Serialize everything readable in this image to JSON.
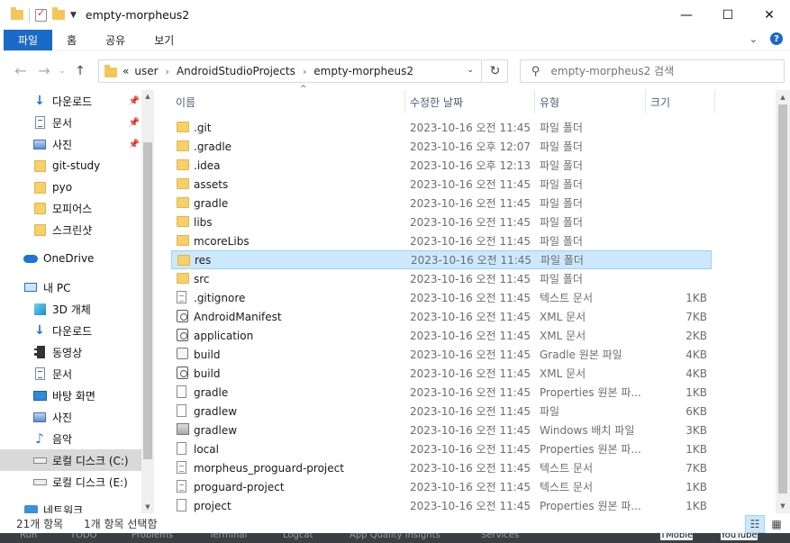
{
  "window": {
    "title": "empty-morpheus2",
    "minimize": "—",
    "maximize": "☐",
    "close": "✕"
  },
  "ribbon": {
    "tabs": [
      "파일",
      "홈",
      "공유",
      "보기"
    ],
    "expand": "⌄",
    "help": "?"
  },
  "address": {
    "back": "←",
    "forward": "→",
    "recent": "⌄",
    "up": "↑",
    "overflow": "«",
    "crumbs": [
      "user",
      "AndroidStudioProjects",
      "empty-morpheus2"
    ],
    "crumb_sep": "›",
    "dropdown": "⌄",
    "refresh": "↻"
  },
  "search": {
    "placeholder": "empty-morpheus2 검색",
    "icon": "⚲"
  },
  "nav": {
    "items": [
      {
        "label": "다운로드",
        "icon": "download-icon",
        "pinned": true
      },
      {
        "label": "문서",
        "icon": "document-icon",
        "pinned": true
      },
      {
        "label": "사진",
        "icon": "pictures-icon",
        "pinned": true
      },
      {
        "label": "git-study",
        "icon": "folder-icon"
      },
      {
        "label": "pyo",
        "icon": "folder-icon"
      },
      {
        "label": "모피어스",
        "icon": "folder-icon"
      },
      {
        "label": "스크린샷",
        "icon": "folder-icon"
      },
      {
        "label": "OneDrive",
        "icon": "onedrive-icon"
      },
      {
        "label": "내 PC",
        "icon": "pc-icon"
      },
      {
        "label": "3D 개체",
        "icon": "3d-objects-icon"
      },
      {
        "label": "다운로드",
        "icon": "download-icon"
      },
      {
        "label": "동영상",
        "icon": "video-icon"
      },
      {
        "label": "문서",
        "icon": "document-icon"
      },
      {
        "label": "바탕 화면",
        "icon": "desktop-icon"
      },
      {
        "label": "사진",
        "icon": "pictures-icon"
      },
      {
        "label": "음악",
        "icon": "music-icon"
      },
      {
        "label": "로컬 디스크 (C:)",
        "icon": "drive-icon",
        "selected": true
      },
      {
        "label": "로컬 디스크 (E:)",
        "icon": "drive-icon"
      },
      {
        "label": "네트워크",
        "icon": "network-icon"
      }
    ],
    "pin_glyph": "📌",
    "scroll_up": "▲",
    "scroll_down": "▼"
  },
  "columns": {
    "name": "이름",
    "date": "수정한 날짜",
    "type": "유형",
    "size": "크기",
    "sort_indicator": "^"
  },
  "files": [
    {
      "name": ".git",
      "date": "2023-10-16 오전 11:45",
      "type": "파일 폴더",
      "size": "",
      "icon": "folder-icon"
    },
    {
      "name": ".gradle",
      "date": "2023-10-16 오후 12:07",
      "type": "파일 폴더",
      "size": "",
      "icon": "folder-icon"
    },
    {
      "name": ".idea",
      "date": "2023-10-16 오후 12:13",
      "type": "파일 폴더",
      "size": "",
      "icon": "folder-icon"
    },
    {
      "name": "assets",
      "date": "2023-10-16 오전 11:45",
      "type": "파일 폴더",
      "size": "",
      "icon": "folder-icon"
    },
    {
      "name": "gradle",
      "date": "2023-10-16 오전 11:45",
      "type": "파일 폴더",
      "size": "",
      "icon": "folder-icon"
    },
    {
      "name": "libs",
      "date": "2023-10-16 오전 11:45",
      "type": "파일 폴더",
      "size": "",
      "icon": "folder-icon"
    },
    {
      "name": "mcoreLibs",
      "date": "2023-10-16 오전 11:45",
      "type": "파일 폴더",
      "size": "",
      "icon": "folder-icon"
    },
    {
      "name": "res",
      "date": "2023-10-16 오전 11:45",
      "type": "파일 폴더",
      "size": "",
      "icon": "folder-icon",
      "selected": true
    },
    {
      "name": "src",
      "date": "2023-10-16 오전 11:45",
      "type": "파일 폴더",
      "size": "",
      "icon": "folder-icon"
    },
    {
      "name": ".gitignore",
      "date": "2023-10-16 오전 11:45",
      "type": "텍스트 문서",
      "size": "1KB",
      "icon": "text-file-icon"
    },
    {
      "name": "AndroidManifest",
      "date": "2023-10-16 오전 11:45",
      "type": "XML 문서",
      "size": "7KB",
      "icon": "xml-file-icon"
    },
    {
      "name": "application",
      "date": "2023-10-16 오전 11:45",
      "type": "XML 문서",
      "size": "2KB",
      "icon": "xml-file-icon"
    },
    {
      "name": "build",
      "date": "2023-10-16 오전 11:45",
      "type": "Gradle 원본 파일",
      "size": "4KB",
      "icon": "gradle-file-icon"
    },
    {
      "name": "build",
      "date": "2023-10-16 오전 11:45",
      "type": "XML 문서",
      "size": "4KB",
      "icon": "xml-file-icon"
    },
    {
      "name": "gradle",
      "date": "2023-10-16 오전 11:45",
      "type": "Properties 원본 파...",
      "size": "1KB",
      "icon": "file-icon"
    },
    {
      "name": "gradlew",
      "date": "2023-10-16 오전 11:45",
      "type": "파일",
      "size": "6KB",
      "icon": "file-icon"
    },
    {
      "name": "gradlew",
      "date": "2023-10-16 오전 11:45",
      "type": "Windows 배치 파일",
      "size": "3KB",
      "icon": "batch-file-icon"
    },
    {
      "name": "local",
      "date": "2023-10-16 오전 11:45",
      "type": "Properties 원본 파...",
      "size": "1KB",
      "icon": "file-icon"
    },
    {
      "name": "morpheus_proguard-project",
      "date": "2023-10-16 오전 11:45",
      "type": "텍스트 문서",
      "size": "7KB",
      "icon": "text-file-icon"
    },
    {
      "name": "proguard-project",
      "date": "2023-10-16 오전 11:45",
      "type": "텍스트 문서",
      "size": "1KB",
      "icon": "text-file-icon"
    },
    {
      "name": "project",
      "date": "2023-10-16 오전 11:45",
      "type": "Properties 원본 파...",
      "size": "1KB",
      "icon": "file-icon"
    }
  ],
  "status": {
    "count": "21개 항목",
    "selection": "1개 항목 선택함",
    "details_view": "☷",
    "icons_view": "▦"
  },
  "ide": {
    "items": [
      "Run",
      "TODO",
      "Problems",
      "Terminal",
      "Logcat",
      "App Quality Insights",
      "Services"
    ],
    "right": [
      "TMoble",
      "YouTube"
    ]
  },
  "colors": {
    "accent": "#1b6ac9",
    "selection": "#cce8ff",
    "selection_border": "#99d1ff",
    "folder": "#f7d06b"
  }
}
